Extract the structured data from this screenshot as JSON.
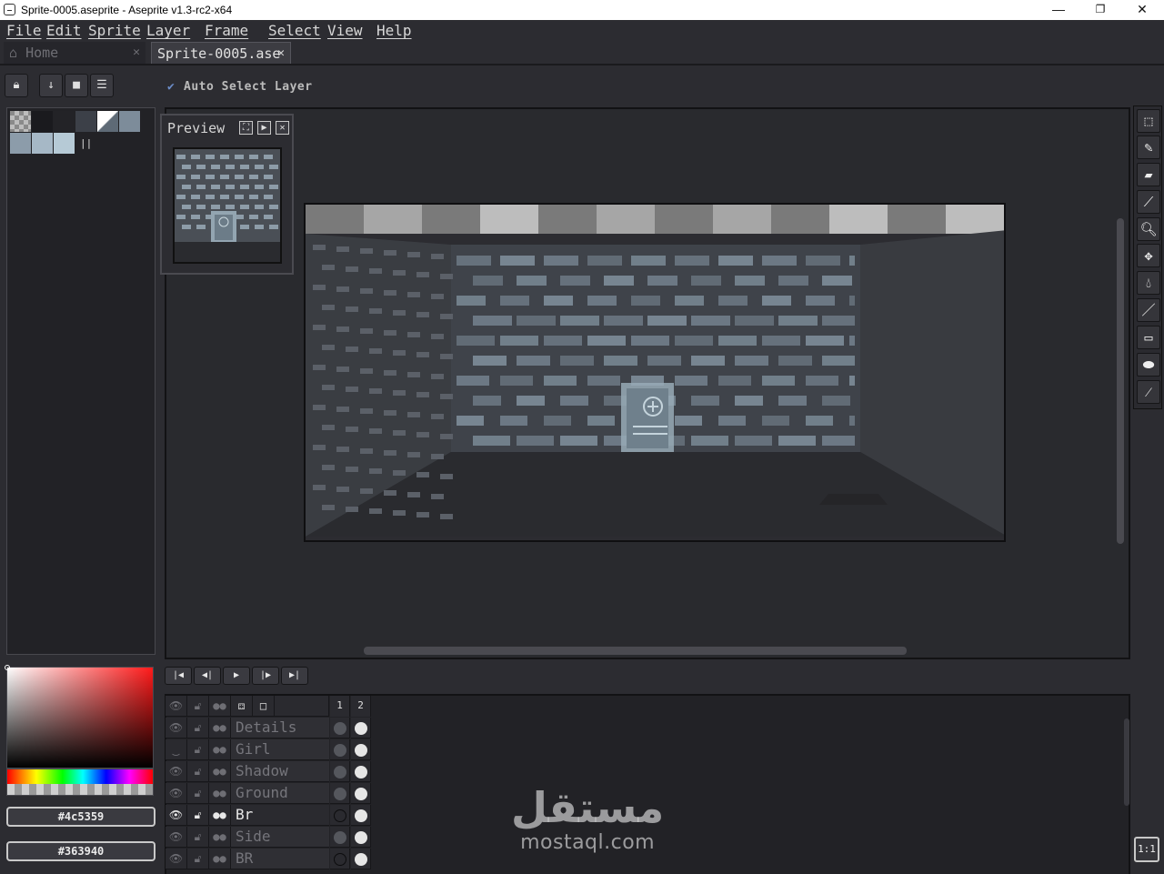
{
  "window": {
    "title": "Sprite-0005.aseprite - Aseprite v1.3-rc2-x64",
    "minimize": "—",
    "maximize": "❐",
    "close": "✕"
  },
  "menu": [
    "File",
    "Edit",
    "Sprite",
    "Layer",
    "Frame",
    "Select",
    "View",
    "Help"
  ],
  "tabs": {
    "home": "Home",
    "active": "Sprite-0005.ase",
    "close": "✕"
  },
  "context": {
    "auto_select_label": "Auto Select Layer",
    "auto_select_checked": true
  },
  "preview": {
    "title": "Preview"
  },
  "colors": {
    "foreground_hex": "#4c5359",
    "background_hex": "#363940"
  },
  "palette_swatches": [
    "#c8c8c8",
    "#1a1a1e",
    "#232327",
    "#3c4048",
    "#5e6a76",
    "#7d8c9a",
    "#8c9caa",
    "#a6b8c6",
    "#b6cad6"
  ],
  "timeline": {
    "frames": [
      "1",
      "2"
    ],
    "layers": [
      {
        "name": "Details",
        "visible": true,
        "selected": false,
        "frame1": "filled"
      },
      {
        "name": "Girl",
        "visible": false,
        "selected": false,
        "frame1": "filled"
      },
      {
        "name": "Shadow",
        "visible": true,
        "selected": false,
        "frame1": "filled"
      },
      {
        "name": "Ground",
        "visible": true,
        "selected": false,
        "frame1": "filled"
      },
      {
        "name": "Br",
        "visible": true,
        "selected": true,
        "frame1": "empty"
      },
      {
        "name": "Side",
        "visible": true,
        "selected": false,
        "frame1": "filled"
      },
      {
        "name": "BR",
        "visible": true,
        "selected": false,
        "frame1": "empty"
      }
    ]
  },
  "zoom_button": "1:1",
  "watermark": {
    "arabic": "مستقل",
    "latin": "mostaql.com"
  }
}
